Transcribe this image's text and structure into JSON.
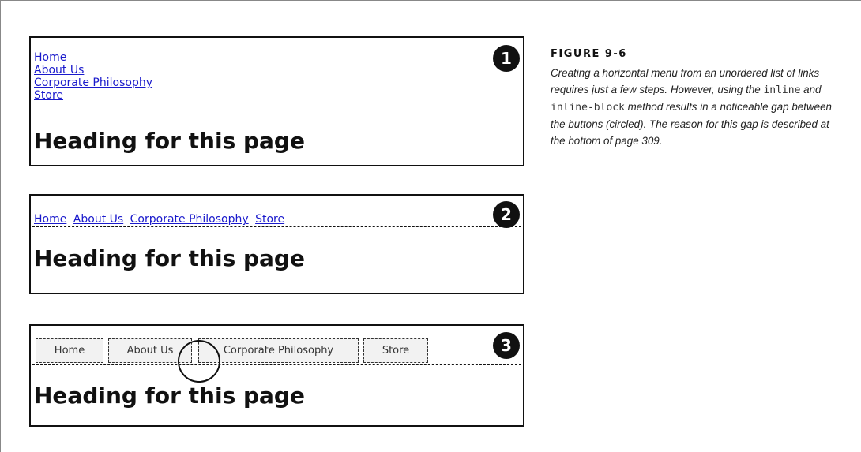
{
  "screenshot1": {
    "badge": "1",
    "nav": [
      "Home",
      "About Us",
      "Corporate Philosophy",
      "Store"
    ],
    "heading": "Heading for this page"
  },
  "screenshot2": {
    "badge": "2",
    "nav": [
      "Home",
      "About Us",
      "Corporate Philosophy",
      "Store"
    ],
    "heading": "Heading for this page"
  },
  "screenshot3": {
    "badge": "3",
    "buttons": [
      "Home",
      "About Us",
      "Corporate Philosophy",
      "Store"
    ],
    "heading": "Heading for this page"
  },
  "figure": {
    "label": "FIGURE 9-6",
    "caption_part1": "Creating a horizontal menu from an unordered list of links requires just a few steps. However, using the",
    "code1": "inline",
    "caption_and": "and",
    "code2": "inline-block",
    "caption_part2": "method results in a noticeable gap between the buttons (circled). The reason for this gap is described at the bottom of page 309."
  }
}
